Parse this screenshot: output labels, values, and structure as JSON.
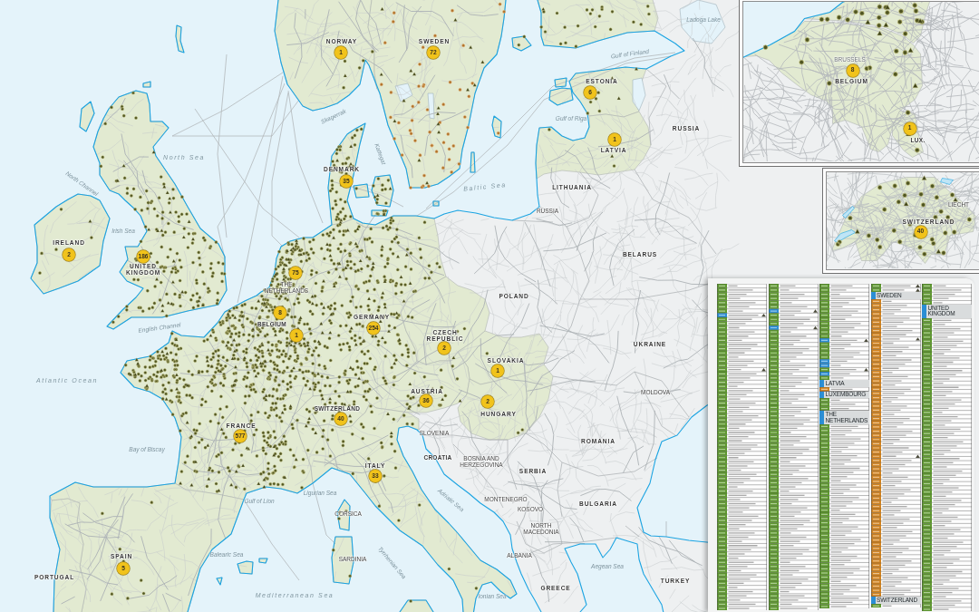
{
  "map": {
    "countries": [
      {
        "label": "NORWAY",
        "highlighted": true,
        "count": "1"
      },
      {
        "label": "SWEDEN",
        "highlighted": true,
        "count": "72"
      },
      {
        "highlighted": true
      },
      {
        "label": "ESTONIA",
        "highlighted": true,
        "count": "6"
      },
      {
        "label": "RUSSIA",
        "highlighted": false
      },
      {
        "label": "LATVIA",
        "highlighted": true,
        "count": "1"
      },
      {
        "label": "DENMARK",
        "highlighted": true,
        "count": "35"
      },
      {
        "label": "LITHUANIA",
        "highlighted": false
      },
      {
        "label": "RUSSIA",
        "highlighted": false
      },
      {
        "label": "IRELAND",
        "highlighted": true,
        "count": "2"
      },
      {
        "label": "UNITED KINGDOM",
        "highlighted": true,
        "count": "186"
      },
      {
        "label": "BELARUS",
        "highlighted": false
      },
      {
        "label": "THE NETHERLANDS",
        "highlighted": true,
        "count": "75"
      },
      {
        "label": "POLAND",
        "highlighted": false
      },
      {
        "label": "BELGIUM",
        "highlighted": true,
        "count": "8"
      },
      {
        "label": "GERMANY",
        "highlighted": true,
        "count": "254"
      },
      {
        "highlighted": true,
        "count": "1"
      },
      {
        "label": "CZECH REPUBLIC",
        "highlighted": true,
        "count": "2"
      },
      {
        "label": "UKRAINE",
        "highlighted": false
      },
      {
        "label": "SLOVAKIA",
        "highlighted": true,
        "count": "1"
      },
      {
        "label": "AUSTRIA",
        "highlighted": true,
        "count": "36"
      },
      {
        "label": "MOLDOVA",
        "highlighted": false
      },
      {
        "label": "HUNGARY",
        "highlighted": true,
        "count": "2"
      },
      {
        "label": "SWITZERLAND",
        "highlighted": true,
        "count": "40"
      },
      {
        "label": "FRANCE",
        "highlighted": true,
        "count": "577"
      },
      {
        "label": "SLOVENIA",
        "highlighted": false
      },
      {
        "label": "ROMANIA",
        "highlighted": false
      },
      {
        "label": "CROATIA",
        "highlighted": false
      },
      {
        "label": "ITALY",
        "highlighted": true,
        "count": "33"
      },
      {
        "label": "BOSNIA AND HERZEGOVINA",
        "highlighted": false
      },
      {
        "label": "SERBIA",
        "highlighted": false
      },
      {
        "label": "MONTENEGRO",
        "highlighted": false
      },
      {
        "label": "BULGARIA",
        "highlighted": false
      },
      {
        "label": "KOSOVO",
        "highlighted": false
      },
      {
        "label": "NORTH MACEDONIA",
        "highlighted": false
      },
      {
        "label": "ALBANIA",
        "highlighted": false
      },
      {
        "label": "SPAIN",
        "highlighted": true,
        "count": "5"
      },
      {
        "label": "GREECE",
        "highlighted": false
      },
      {
        "label": "PORTUGAL",
        "highlighted": true
      },
      {
        "label": "TURKEY",
        "highlighted": false
      }
    ],
    "regions": [
      "CORSICA",
      "SARDINIA"
    ],
    "seas": [
      "Ladoga Lake",
      "Gulf of Finland",
      "Skagerrak",
      "Gulf of Riga",
      "Kattegat",
      "North Sea",
      "North Channel",
      "Baltic Sea",
      "Irish Sea",
      "English Channel",
      "Atlantic Ocean",
      "Bay of Biscay",
      "Gulf of Lion",
      "Ligurian Sea",
      "Adriatic Sea",
      "Balearic Sea",
      "Tyrrhenian Sea",
      "Aegean Sea",
      "Mediterranean Sea",
      "Ionian Sea"
    ]
  },
  "insets": [
    {
      "countries": [
        {
          "highlighted": true
        },
        {
          "label": "BELGIUM",
          "highlighted": true,
          "count": "8"
        },
        {
          "label": "LUX.",
          "highlighted": true,
          "count": "1"
        }
      ],
      "cities": [
        "BRUSSELS"
      ]
    },
    {
      "countries": [
        {
          "label": "SWITZERLAND",
          "highlighted": true,
          "count": "40"
        },
        {
          "label": "LIECHT",
          "highlighted": false
        }
      ]
    }
  ],
  "site_list": {
    "headings": [
      "LATVIA",
      "LUXEMBOURG",
      "THE NETHERLANDS",
      "SWEDEN",
      "SWITZERLAND",
      "UNITED KINGDOM"
    ]
  }
}
